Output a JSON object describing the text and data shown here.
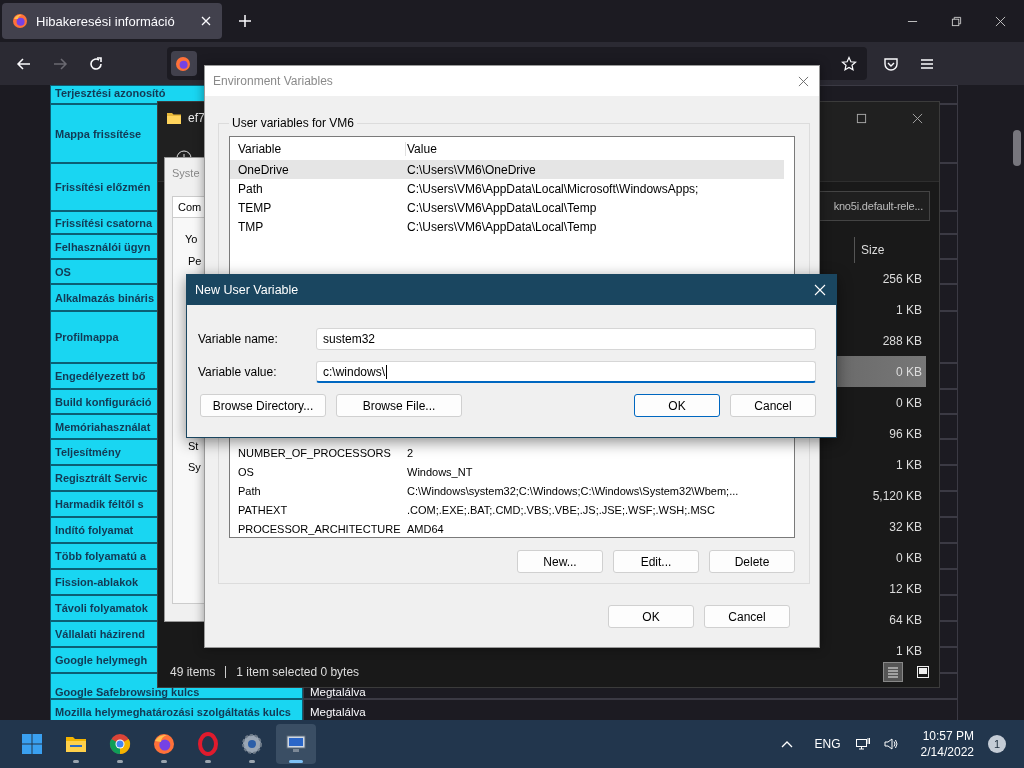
{
  "browser": {
    "tab": {
      "title": "Hibakeresési információ",
      "selected": true
    }
  },
  "support_table": {
    "rows": [
      {
        "label": "Terjesztési azonosító"
      },
      {
        "label": "Mappa frissítése"
      },
      {
        "label": "Frissítési előzmén"
      },
      {
        "label": "Frissítési csatorna"
      },
      {
        "label": "Felhasználói ügyn"
      },
      {
        "label": "OS"
      },
      {
        "label": "Alkalmazás bináris"
      },
      {
        "label": "Profilmappa"
      },
      {
        "label": "Engedélyezett bő"
      },
      {
        "label": "Build konfiguráció"
      },
      {
        "label": "Memóriahasználat"
      },
      {
        "label": "Teljesítmény"
      },
      {
        "label": "Regisztrált Servic"
      },
      {
        "label": "Harmadik féltől s"
      },
      {
        "label": "Indító folyamat"
      },
      {
        "label": "Több folyamatú a"
      },
      {
        "label": "Fission-ablakok"
      },
      {
        "label": "Távoli folyamatok"
      },
      {
        "label": "Vállalati házirend"
      },
      {
        "label": "Google helymegh"
      },
      {
        "label": "Google Safebrowsing kulcs",
        "value": "Megtalálva"
      },
      {
        "label": "Mozilla helymeghatározási szolgáltatás kulcs",
        "value": "Megtalálva"
      }
    ]
  },
  "explorer": {
    "title": "ef7",
    "address": "kno5i.default-rele...",
    "column": "Size",
    "rows": [
      {
        "size": "256 KB",
        "selected": false
      },
      {
        "size": "1 KB",
        "selected": false
      },
      {
        "size": "288 KB",
        "selected": false
      },
      {
        "size": "0 KB",
        "selected": true
      },
      {
        "size": "0 KB",
        "selected": false
      },
      {
        "size": "96 KB",
        "selected": false
      },
      {
        "size": "1 KB",
        "selected": false
      },
      {
        "size": "5,120 KB",
        "selected": false
      },
      {
        "size": "32 KB",
        "selected": false
      },
      {
        "size": "0 KB",
        "selected": false
      },
      {
        "size": "12 KB",
        "selected": false
      },
      {
        "size": "64 KB",
        "selected": false
      },
      {
        "size": "1 KB",
        "selected": false
      }
    ],
    "status": [
      "49 items",
      "1 item selected  0 bytes"
    ],
    "views": [
      {
        "kind": "details",
        "selected": true
      },
      {
        "kind": "tiles",
        "selected": false
      }
    ]
  },
  "system_properties": {
    "title": "Syste",
    "tab": "Com",
    "texts": [
      "Yo",
      "Pe",
      "St",
      "Sy"
    ]
  },
  "environment_variables": {
    "title": "Environment Variables",
    "user_group": "User variables for VM6",
    "columns": [
      "Variable",
      "Value"
    ],
    "user_vars": [
      {
        "name": "OneDrive",
        "value": "C:\\Users\\VM6\\OneDrive",
        "selected": true
      },
      {
        "name": "Path",
        "value": "C:\\Users\\VM6\\AppData\\Local\\Microsoft\\WindowsApps;",
        "selected": false
      },
      {
        "name": "TEMP",
        "value": "C:\\Users\\VM6\\AppData\\Local\\Temp",
        "selected": false
      },
      {
        "name": "TMP",
        "value": "C:\\Users\\VM6\\AppData\\Local\\Temp",
        "selected": false
      }
    ],
    "system_vars": [
      {
        "name": "NUMBER_OF_PROCESSORS",
        "value": "2"
      },
      {
        "name": "OS",
        "value": "Windows_NT"
      },
      {
        "name": "Path",
        "value": "C:\\Windows\\system32;C:\\Windows;C:\\Windows\\System32\\Wbem;..."
      },
      {
        "name": "PATHEXT",
        "value": ".COM;.EXE;.BAT;.CMD;.VBS;.VBE;.JS;.JSE;.WSF;.WSH;.MSC"
      },
      {
        "name": "PROCESSOR_ARCHITECTURE",
        "value": "AMD64"
      }
    ],
    "system_buttons": [
      "New...",
      "Edit...",
      "Delete"
    ],
    "buttons": [
      "OK",
      "Cancel"
    ]
  },
  "new_variable_dialog": {
    "title": "New User Variable",
    "fields": [
      {
        "label": "Variable name:",
        "value": "sustem32",
        "focused": false
      },
      {
        "label": "Variable value:",
        "value": "c:\\windows\\",
        "focused": true
      }
    ],
    "browse_buttons": [
      "Browse Directory...",
      "Browse File..."
    ],
    "buttons": [
      {
        "label": "OK",
        "default": true
      },
      {
        "label": "Cancel",
        "default": false
      }
    ]
  },
  "taskbar": {
    "apps": [
      {
        "kind": "start",
        "running": false,
        "selected": false
      },
      {
        "kind": "folder",
        "running": true,
        "selected": false
      },
      {
        "kind": "chrome",
        "running": true,
        "selected": false
      },
      {
        "kind": "firefox",
        "running": true,
        "selected": false
      },
      {
        "kind": "opera",
        "running": true,
        "selected": false
      },
      {
        "kind": "settings",
        "running": true,
        "selected": false
      },
      {
        "kind": "remote",
        "running": true,
        "selected": true
      }
    ],
    "language": "ENG",
    "time": "10:57 PM",
    "date": "2/14/2022",
    "notifications": "1"
  }
}
